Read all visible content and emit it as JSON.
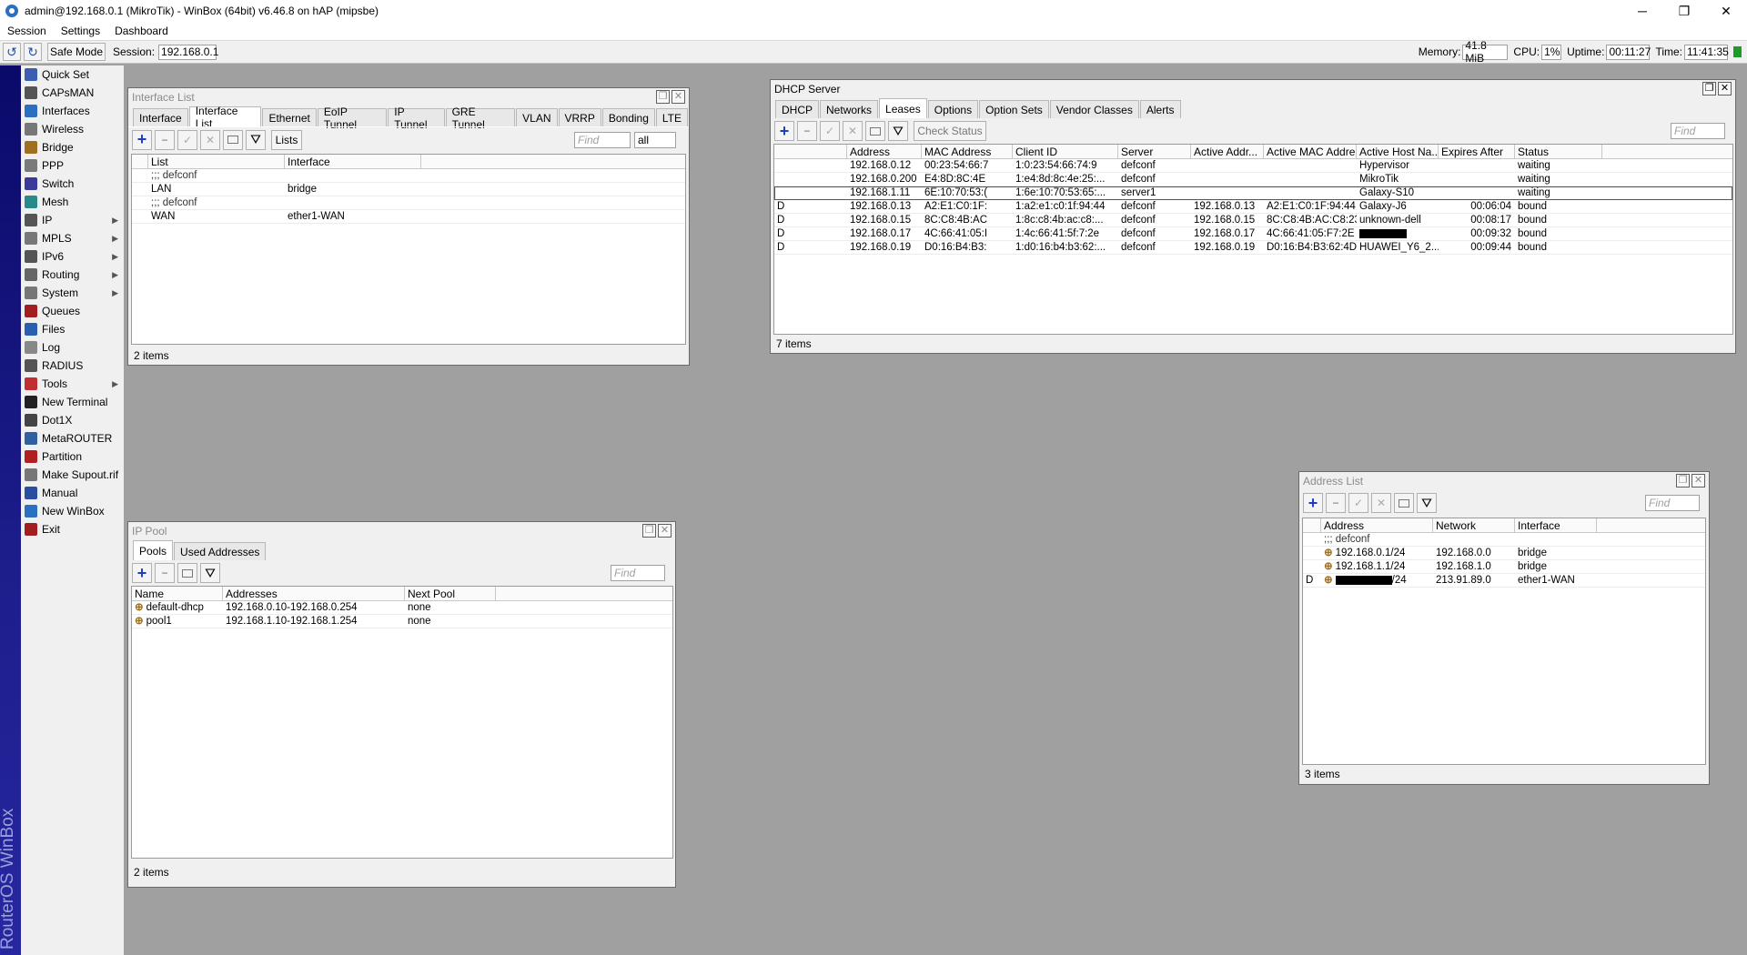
{
  "window": {
    "title": "admin@192.168.0.1 (MikroTik) - WinBox (64bit) v6.46.8 on hAP (mipsbe)",
    "minimize": "─",
    "maximize": "❐",
    "close": "✕"
  },
  "menubar": [
    "Session",
    "Settings",
    "Dashboard"
  ],
  "toolbar": {
    "undo": "↺",
    "redo": "↻",
    "safe_mode": "Safe Mode",
    "session_label": "Session:",
    "session_value": "192.168.0.1",
    "memory_label": "Memory:",
    "memory_value": "41.8 MiB",
    "cpu_label": "CPU:",
    "cpu_value": "1%",
    "uptime_label": "Uptime:",
    "uptime_value": "00:11:27",
    "time_label": "Time:",
    "time_value": "11:41:35"
  },
  "sidebar_brand": "RouterOS WinBox",
  "sidebar": [
    {
      "label": "Quick Set",
      "icon": "quickset-icon",
      "arrow": ""
    },
    {
      "label": "CAPsMAN",
      "icon": "capsman-icon",
      "arrow": ""
    },
    {
      "label": "Interfaces",
      "icon": "interfaces-icon",
      "arrow": ""
    },
    {
      "label": "Wireless",
      "icon": "wireless-icon",
      "arrow": ""
    },
    {
      "label": "Bridge",
      "icon": "bridge-icon",
      "arrow": ""
    },
    {
      "label": "PPP",
      "icon": "ppp-icon",
      "arrow": ""
    },
    {
      "label": "Switch",
      "icon": "switch-icon",
      "arrow": ""
    },
    {
      "label": "Mesh",
      "icon": "mesh-icon",
      "arrow": ""
    },
    {
      "label": "IP",
      "icon": "ip-icon",
      "arrow": "▶"
    },
    {
      "label": "MPLS",
      "icon": "mpls-icon",
      "arrow": "▶"
    },
    {
      "label": "IPv6",
      "icon": "ipv6-icon",
      "arrow": "▶"
    },
    {
      "label": "Routing",
      "icon": "routing-icon",
      "arrow": "▶"
    },
    {
      "label": "System",
      "icon": "system-icon",
      "arrow": "▶"
    },
    {
      "label": "Queues",
      "icon": "queues-icon",
      "arrow": ""
    },
    {
      "label": "Files",
      "icon": "files-icon",
      "arrow": ""
    },
    {
      "label": "Log",
      "icon": "log-icon",
      "arrow": ""
    },
    {
      "label": "RADIUS",
      "icon": "radius-icon",
      "arrow": ""
    },
    {
      "label": "Tools",
      "icon": "tools-icon",
      "arrow": "▶"
    },
    {
      "label": "New Terminal",
      "icon": "terminal-icon",
      "arrow": ""
    },
    {
      "label": "Dot1X",
      "icon": "dot1x-icon",
      "arrow": ""
    },
    {
      "label": "MetaROUTER",
      "icon": "metarouter-icon",
      "arrow": ""
    },
    {
      "label": "Partition",
      "icon": "partition-icon",
      "arrow": ""
    },
    {
      "label": "Make Supout.rif",
      "icon": "supout-icon",
      "arrow": ""
    },
    {
      "label": "Manual",
      "icon": "manual-icon",
      "arrow": ""
    },
    {
      "label": "New WinBox",
      "icon": "winbox-icon",
      "arrow": ""
    },
    {
      "label": "Exit",
      "icon": "exit-icon",
      "arrow": ""
    }
  ],
  "interface_list": {
    "title": "Interface List",
    "tabs": [
      "Interface",
      "Interface List",
      "Ethernet",
      "EoIP Tunnel",
      "IP Tunnel",
      "GRE Tunnel",
      "VLAN",
      "VRRP",
      "Bonding",
      "LTE"
    ],
    "selected_tab": 1,
    "lists_button": "Lists",
    "find_placeholder": "Find",
    "filter_value": "all",
    "columns": [
      "List",
      "Interface"
    ],
    "rows": [
      {
        "comment": ";;; defconf"
      },
      {
        "list": "LAN",
        "interface": "bridge"
      },
      {
        "comment": ";;; defconf"
      },
      {
        "list": "WAN",
        "interface": "ether1-WAN"
      }
    ],
    "status": "2 items"
  },
  "dhcp_server": {
    "title": "DHCP Server",
    "tabs": [
      "DHCP",
      "Networks",
      "Leases",
      "Options",
      "Option Sets",
      "Vendor Classes",
      "Alerts"
    ],
    "selected_tab": 2,
    "check_status": "Check Status",
    "find_placeholder": "Find",
    "columns": [
      "",
      "Address",
      "MAC Address",
      "Client ID",
      "Server",
      "Active Addr...",
      "Active MAC Addre...",
      "Active Host Na...",
      "Expires After",
      "Status"
    ],
    "rows": [
      [
        "",
        "192.168.0.12",
        "00:23:54:66:7",
        "1:0:23:54:66:74:9",
        "defconf",
        "",
        "",
        "Hypervisor",
        "",
        "waiting"
      ],
      [
        "",
        "192.168.0.200",
        "E4:8D:8C:4E",
        "1:e4:8d:8c:4e:25:...",
        "defconf",
        "",
        "",
        "MikroTik",
        "",
        "waiting"
      ],
      [
        "",
        "192.168.1.11",
        "6E:10:70:53:(",
        "1:6e:10:70:53:65:...",
        "server1",
        "",
        "",
        "Galaxy-S10",
        "",
        "waiting"
      ],
      [
        "D",
        "192.168.0.13",
        "A2:E1:C0:1F:",
        "1:a2:e1:c0:1f:94:44",
        "defconf",
        "192.168.0.13",
        "A2:E1:C0:1F:94:44",
        "Galaxy-J6",
        "00:06:04",
        "bound"
      ],
      [
        "D",
        "192.168.0.15",
        "8C:C8:4B:AC",
        "1:8c:c8:4b:ac:c8:...",
        "defconf",
        "192.168.0.15",
        "8C:C8:4B:AC:C8:23",
        "unknown-dell",
        "00:08:17",
        "bound"
      ],
      [
        "D",
        "192.168.0.17",
        "4C:66:41:05:I",
        "1:4c:66:41:5f:7:2e",
        "defconf",
        "192.168.0.17",
        "4C:66:41:05:F7:2E",
        "",
        "00:09:32",
        "bound"
      ],
      [
        "D",
        "192.168.0.19",
        "D0:16:B4:B3:",
        "1:d0:16:b4:b3:62:...",
        "defconf",
        "192.168.0.19",
        "D0:16:B4:B3:62:4D",
        "HUAWEI_Y6_2...",
        "00:09:44",
        "bound"
      ]
    ],
    "selected_row": 2,
    "status": "7 items"
  },
  "ip_pool": {
    "title": "IP Pool",
    "tabs": [
      "Pools",
      "Used Addresses"
    ],
    "selected_tab": 0,
    "find_placeholder": "Find",
    "columns": [
      "Name",
      "Addresses",
      "Next Pool"
    ],
    "rows": [
      [
        "default-dhcp",
        "192.168.0.10-192.168.0.254",
        "none"
      ],
      [
        "pool1",
        "192.168.1.10-192.168.1.254",
        "none"
      ]
    ],
    "status": "2 items"
  },
  "address_list": {
    "title": "Address List",
    "find_placeholder": "Find",
    "columns": [
      "Address",
      "Network",
      "Interface"
    ],
    "rows": [
      {
        "comment": ";;; defconf"
      },
      {
        "flag": "",
        "address": "192.168.0.1/24",
        "network": "192.168.0.0",
        "interface": "bridge"
      },
      {
        "flag": "",
        "address": "192.168.1.1/24",
        "network": "192.168.1.0",
        "interface": "bridge"
      },
      {
        "flag": "D",
        "address": "/24",
        "network": "213.91.89.0",
        "interface": "ether1-WAN"
      }
    ],
    "status": "3 items"
  }
}
